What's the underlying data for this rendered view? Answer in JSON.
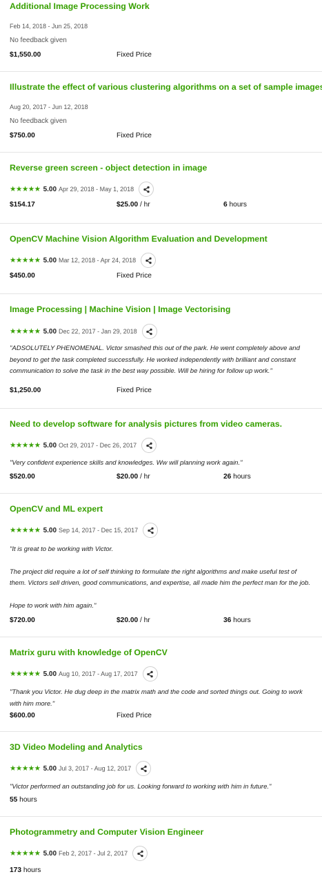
{
  "accent_color": "#37a000",
  "jobs": [
    {
      "title": "Additional Image Processing Work",
      "dates": "Feb 14, 2018 - Jun 25, 2018",
      "no_feedback": "No feedback given",
      "amount": "$1,550.00",
      "price_type": "Fixed Price"
    },
    {
      "title": "Illustrate the effect of various clustering algorithms on a set of sample images",
      "dates": "Aug 20, 2017 - Jun 12, 2018",
      "no_feedback": "No feedback given",
      "amount": "$750.00",
      "price_type": "Fixed Price"
    },
    {
      "title": "Reverse green screen - object detection in image",
      "stars": "★★★★★",
      "score": "5.00",
      "dates": "Apr 29, 2018 - May 1, 2018",
      "amount": "$154.17",
      "rate": "$25.00",
      "rate_unit": " / hr",
      "hours": "6",
      "hours_unit": " hours"
    },
    {
      "title": "OpenCV Machine Vision Algorithm Evaluation and Development",
      "stars": "★★★★★",
      "score": "5.00",
      "dates": "Mar 12, 2018 - Apr 24, 2018",
      "amount": "$450.00",
      "price_type": "Fixed Price"
    },
    {
      "title": "Image Processing | Machine Vision | Image Vectorising",
      "stars": "★★★★★",
      "score": "5.00",
      "dates": "Dec 22, 2017 - Jan 29, 2018",
      "feedback": [
        "\"ADSOLUTELY PHENOMENAL. Victor smashed this out of the park. He went completely above and beyond to get the task completed successfully. He worked independently with brilliant and constant communication to solve the task in the best way possible. Will be hiring for follow up work.\""
      ],
      "amount": "$1,250.00",
      "price_type": "Fixed Price"
    },
    {
      "title": "Need to develop software for analysis pictures from video cameras.",
      "stars": "★★★★★",
      "score": "5.00",
      "dates": "Oct 29, 2017 - Dec 26, 2017",
      "feedback": [
        "\"Very confident experience skills and knowledges. Ww will planning work again.\""
      ],
      "amount": "$520.00",
      "rate": "$20.00",
      "rate_unit": " / hr",
      "hours": "26",
      "hours_unit": " hours"
    },
    {
      "title": "OpenCV and ML expert",
      "stars": "★★★★★",
      "score": "5.00",
      "dates": "Sep 14, 2017 - Dec 15, 2017",
      "feedback": [
        "\"It is great to be working with Victor.",
        "The project did require a lot of self thinking to formulate the right algorithms and make useful test of them. Victors sell driven, good communications, and expertise, all made him the perfect man for the job.",
        "Hope to work with him again.\""
      ],
      "amount": "$720.00",
      "rate": "$20.00",
      "rate_unit": " / hr",
      "hours": "36",
      "hours_unit": " hours"
    },
    {
      "title": "Matrix guru with knowledge of OpenCV",
      "stars": "★★★★★",
      "score": "5.00",
      "dates": "Aug 10, 2017 - Aug 17, 2017",
      "feedback": [
        "\"Thank you Victor. He dug deep in the matrix math and the code and sorted things out. Going to work with him more.\""
      ],
      "amount": "$600.00",
      "price_type": "Fixed Price"
    },
    {
      "title": "3D Video Modeling and Analytics",
      "stars": "★★★★★",
      "score": "5.00",
      "dates": "Jul 3, 2017 - Aug 12, 2017",
      "feedback": [
        "\"Victor performed an outstanding job for us. Looking forward to working with him in future.\""
      ],
      "hours": "55",
      "hours_unit": " hours"
    },
    {
      "title": "Photogrammetry and Computer Vision Engineer",
      "stars": "★★★★★",
      "score": "5.00",
      "dates": "Feb 2, 2017 - Jul 2, 2017",
      "hours": "173",
      "hours_unit": " hours"
    }
  ]
}
